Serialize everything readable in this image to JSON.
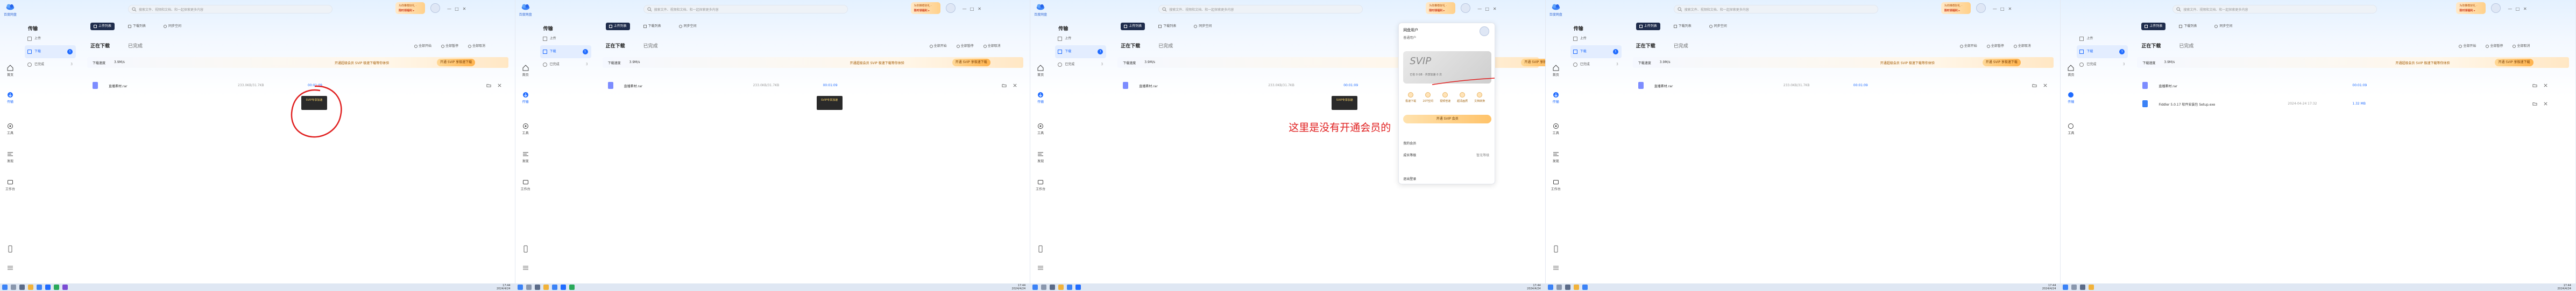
{
  "app": {
    "logo_text": "百度网盘",
    "page_title": "传输",
    "search_placeholder": "搜索文件、视频和文档、和一起探索更多内容",
    "promo_line1": "为你推荐好礼 ·",
    "promo_line2": "限时领福利 ▸",
    "rail": {
      "home": "首页",
      "transfer": "传输",
      "tools": "工具",
      "discover": "发现",
      "storage": "工作台"
    },
    "window_buttons": [
      "—",
      "□",
      "✕"
    ]
  },
  "transfer": {
    "tabs": [
      "上传列表",
      "下载列表",
      "同步空间"
    ],
    "left_items": [
      {
        "label": "上传",
        "count": "",
        "num": ""
      },
      {
        "label": "下载",
        "count": "1",
        "num": ""
      },
      {
        "label": "已完成",
        "count": "",
        "num": "3"
      }
    ],
    "subtabs": {
      "downloading": "正在下载",
      "completed": "已完成"
    },
    "subtab_count": "1",
    "right_links": [
      "全部开始",
      "全部暂停",
      "全部取消"
    ],
    "speed_label": "下载速度",
    "speed_value": "3.9M/s",
    "speed_promo": "开通超级会员 SVIP 极速下载等你体验",
    "speed_button": "开通 SVIP 享极速下载",
    "file": {
      "name": "直播素材.rar",
      "size": "233.0KB/31.7KB",
      "status": "等待中",
      "eta": "00:01:09"
    },
    "tooltip": "SVIP专享加速",
    "completed_file": {
      "name": "Fiddler 5.0.17 软件安装包 Setup.exe",
      "size": "1.32 MB",
      "date": "2024-04-24 17:32",
      "status": "打开目录"
    }
  },
  "svip": {
    "user_name": "网盘用户",
    "user_sub": "普通用户",
    "logo": "SVIP",
    "stat": "已省 0 GB · 共享加速 0 次",
    "perks": [
      "极速下载",
      "20T空间",
      "视频倍速",
      "超清画质",
      "文档转换"
    ],
    "open_button": "开通 SVIP 会员",
    "line1": "我的会员",
    "line2": "成长等级",
    "line2_value": "暂无等级",
    "line3": "退出登录"
  },
  "annotation": {
    "red_note": "这里是没有开通会员的"
  },
  "taskbar": {
    "time": "17:44",
    "date": "2024/4/24"
  }
}
